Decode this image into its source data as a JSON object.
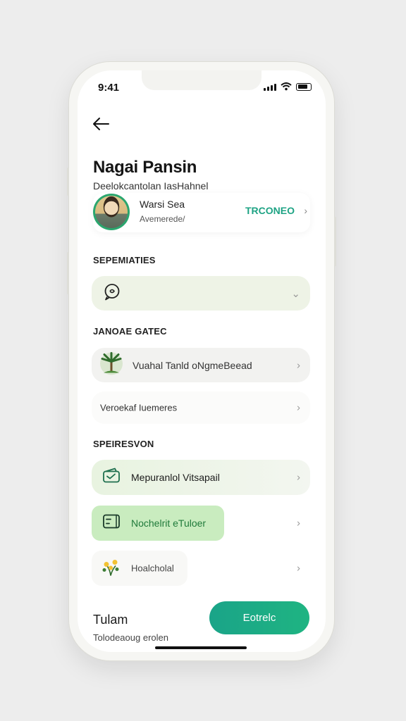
{
  "status_bar": {
    "time": "9:41"
  },
  "header": {
    "title": "Nagai Pansin",
    "subtitle": "Deelokcantolan IasHahnel"
  },
  "profile": {
    "name": "Warsi Sea",
    "sub": "Avemerede/",
    "action_label": "TRCONEO",
    "chevron": "›"
  },
  "sections": {
    "first": "SEPEMIATIES",
    "second": "JANOAE GATEC",
    "third": "SPEIRESVON"
  },
  "rows": {
    "select_row": {
      "chevron": "⌄"
    },
    "plant_row": {
      "label": "Vuahal Tanld oNgmeBeead",
      "chevron": "›"
    },
    "plain_row": {
      "label": "Veroekaf Iuemeres",
      "chevron": "›"
    },
    "card_row": {
      "label": "Mepuranlol Vitsapail",
      "chevron": "›"
    },
    "highlight_row": {
      "label": "Nochelrit eTuloer",
      "chevron": "›"
    },
    "flower_row": {
      "label": "Hoalcholal",
      "chevron": "›"
    }
  },
  "footer": {
    "title": "Tulam",
    "subtitle": "Tolodeaoug erolen",
    "cta_label": "Eotrelc"
  },
  "colors": {
    "accent": "#1ea384",
    "accent_light": "#e4f5df",
    "row_tint": "#eef3e6",
    "row_gray": "#f2f2f0"
  }
}
